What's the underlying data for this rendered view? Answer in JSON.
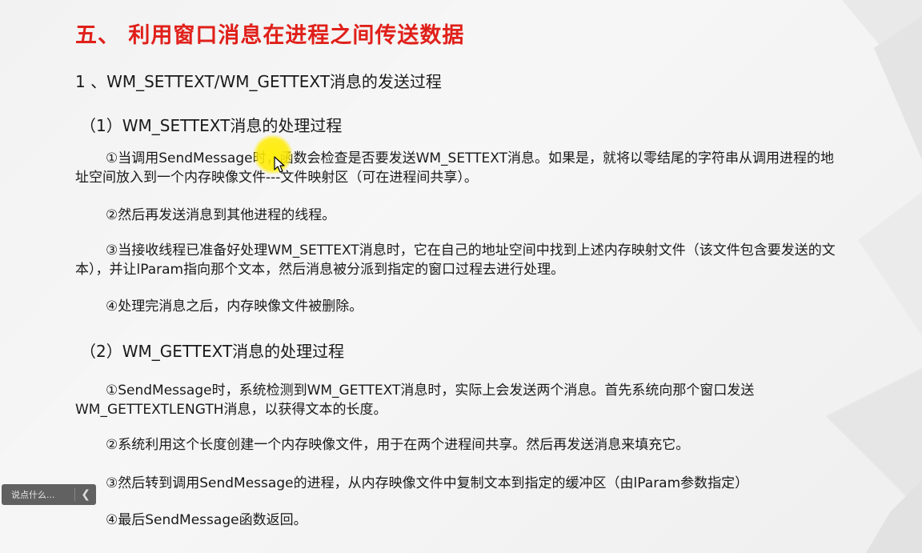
{
  "slide": {
    "title": "五、 利用窗口消息在进程之间传送数据",
    "section1": "1 、WM_SETTEXT/WM_GETTEXT消息的发送过程",
    "sub1": {
      "heading": "（1）WM_SETTEXT消息的处理过程",
      "p1": "①当调用SendMessage时，函数会检查是否要发送WM_SETTEXT消息。如果是，就将以零结尾的字符串从调用进程的地址空间放入到一个内存映像文件---文件映射区（可在进程间共享）。",
      "p2": "②然后再发送消息到其他进程的线程。",
      "p3": "③当接收线程已准备好处理WM_SETTEXT消息时，它在自己的地址空间中找到上述内存映射文件（该文件包含要发送的文本），并让lParam指向那个文本，然后消息被分派到指定的窗口过程去进行处理。",
      "p4": "④处理完消息之后，内存映像文件被删除。"
    },
    "sub2": {
      "heading": "（2）WM_GETTEXT消息的处理过程",
      "p1": "①SendMessage时，系统检测到WM_GETTEXT消息时，实际上会发送两个消息。首先系统向那个窗口发送WM_GETTEXTLENGTH消息，以获得文本的长度。",
      "p2": "②系统利用这个长度创建一个内存映像文件，用于在两个进程间共享。然后再发送消息来填充它。",
      "p3": "③然后转到调用SendMessage的进程，从内存映像文件中复制文本到指定的缓冲区（由lParam参数指定）",
      "p4": "④最后SendMessage函数返回。"
    }
  },
  "overlay": {
    "danmaku_placeholder": "说点什么...",
    "collapse_icon": "chevron-left-icon",
    "cursor_icon": "pointer-cursor-icon",
    "highlight_color": "#ffe600"
  },
  "colors": {
    "title": "#e0201a",
    "text": "#1a1a1a"
  }
}
